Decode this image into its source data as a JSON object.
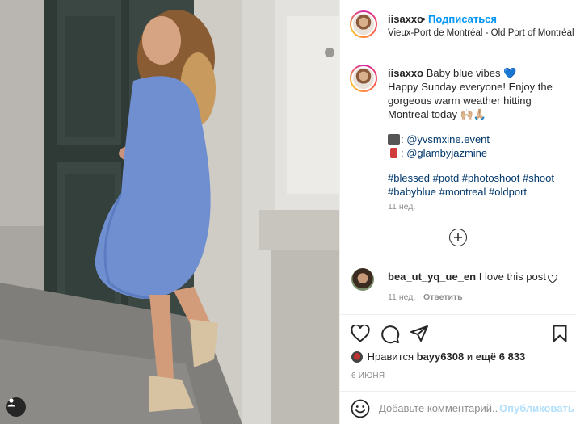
{
  "post": {
    "username": "iisaxxo",
    "separator": "•",
    "follow_label": "Подписаться",
    "location": "Vieux-Port de Montréal - Old Port of Montréal"
  },
  "caption": {
    "username": "iisaxxo",
    "line1": "Baby blue vibes 💙",
    "line2": "Happy Sunday everyone! Enjoy the",
    "line3": "gorgeous warm weather hitting",
    "line4": "Montreal today 🙌🏼🙏🏼",
    "credit_photo": "@yvsmxine.event",
    "credit_makeup": "@glambyjazmine",
    "hashtags_line1": "#blessed #potd #photoshoot #shoot",
    "hashtags_line2": "#babyblue #montreal #oldport",
    "age": "11 нед."
  },
  "comments": [
    {
      "username": "bea_ut_yq_ue_en",
      "text": "I love this post",
      "age": "11 нед.",
      "reply_label": "Ответить"
    }
  ],
  "likes": {
    "prefix": "Нравится",
    "user": "bayy6308",
    "middle": "и",
    "others": "ещё 6 833"
  },
  "date": "6 ИЮНЯ",
  "add_comment": {
    "placeholder": "Добавьте комментарий...",
    "publish_label": "Опубликовать"
  },
  "icons": [
    "heart-icon",
    "comment-icon",
    "share-icon",
    "bookmark-icon",
    "plus-circle-icon",
    "smile-icon",
    "user-tag-icon"
  ],
  "colors": {
    "accent": "#0095f6",
    "publish_disabled": "#b2dffc",
    "link": "#00376b",
    "meta": "#8e8e8e",
    "dress": "#6f8fd0"
  }
}
